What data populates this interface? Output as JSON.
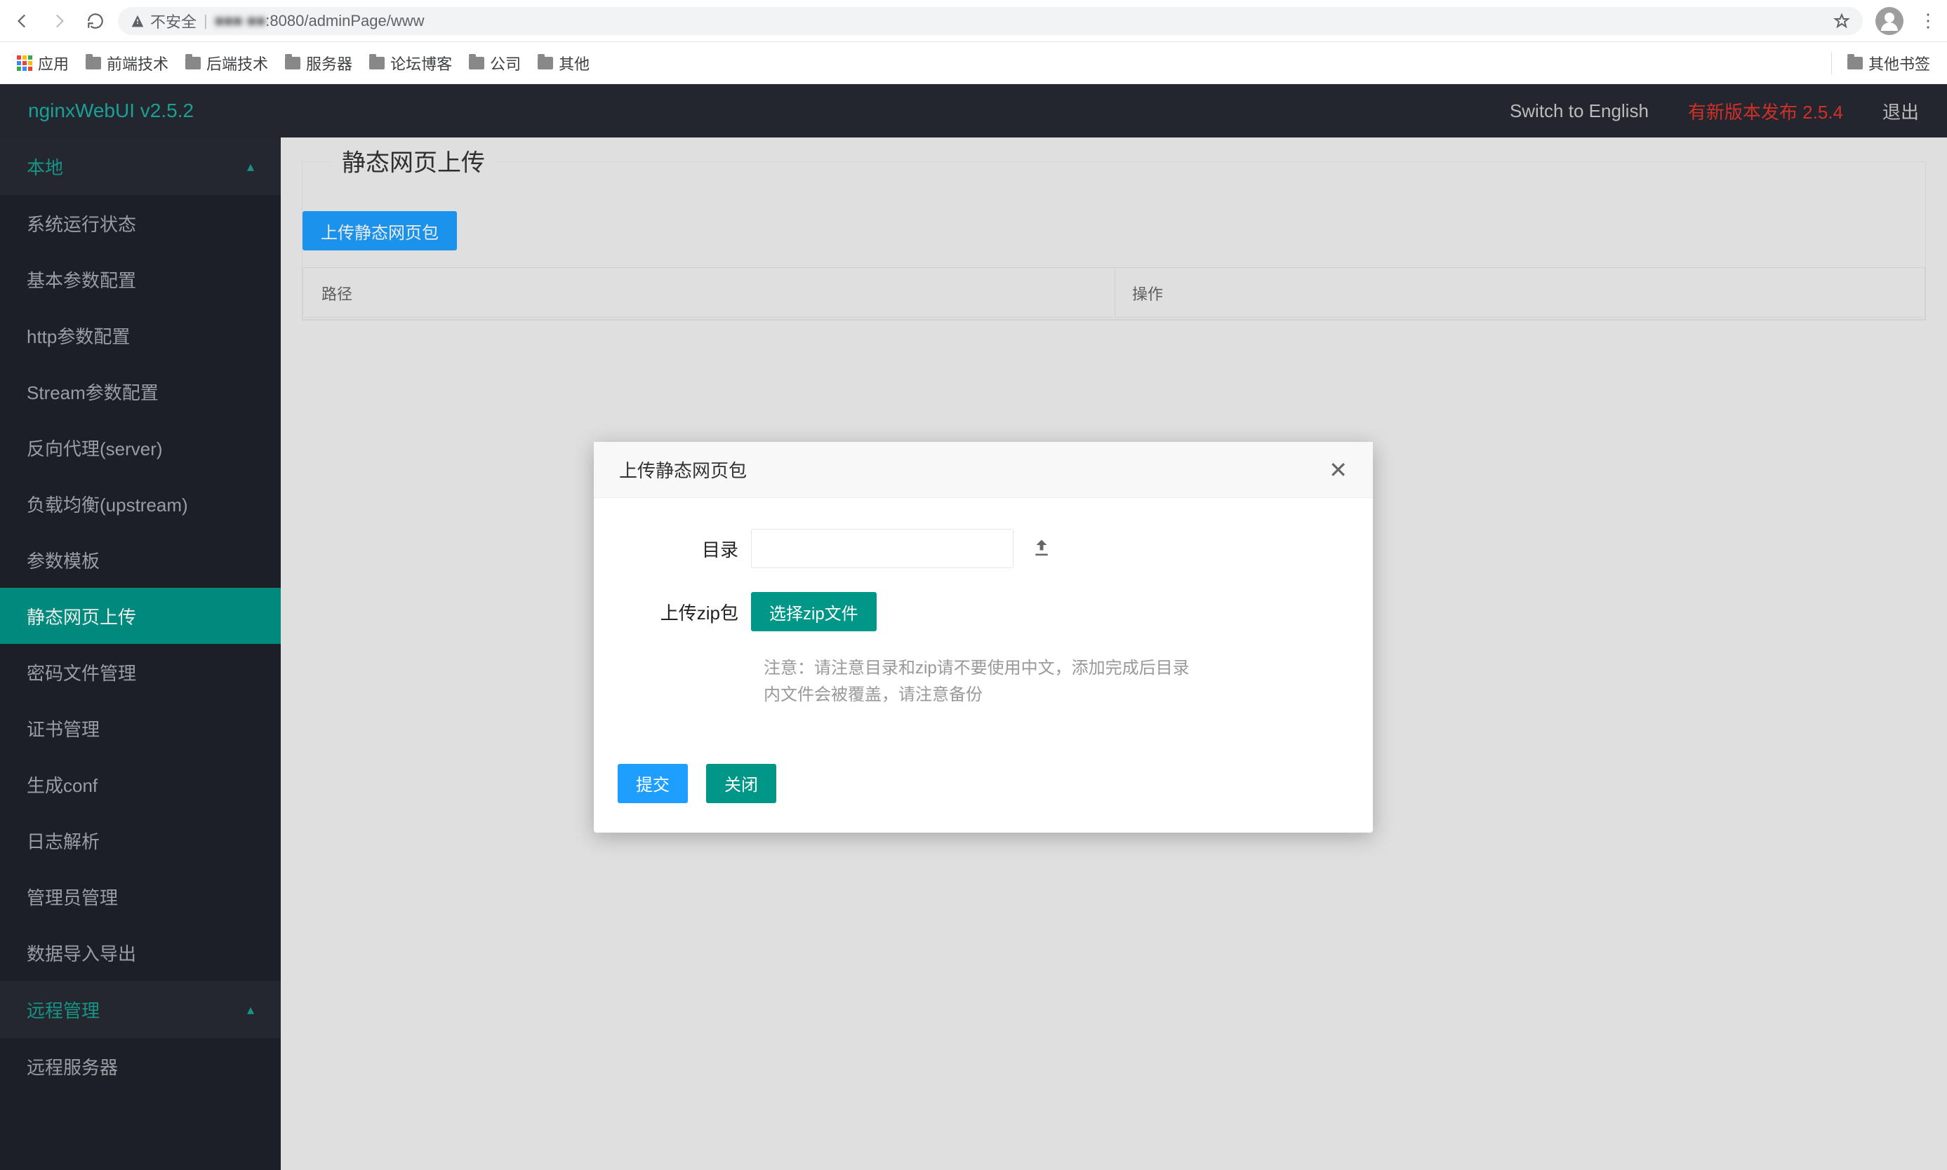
{
  "browser": {
    "insecure_label": "不安全",
    "url_host_obscured": "■■■ ■■",
    "url_rest": ":8080/adminPage/www",
    "apps_label": "应用",
    "bookmarks": [
      "前端技术",
      "后端技术",
      "服务器",
      "论坛博客",
      "公司",
      "其他"
    ],
    "other_bookmarks": "其他书签"
  },
  "header": {
    "brand": "nginxWebUI v2.5.2",
    "switch_lang": "Switch to English",
    "new_version": "有新版本发布 2.5.4",
    "logout": "退出"
  },
  "sidebar": {
    "group_local": "本地",
    "items": [
      "系统运行状态",
      "基本参数配置",
      "http参数配置",
      "Stream参数配置",
      "反向代理(server)",
      "负载均衡(upstream)",
      "参数模板",
      "静态网页上传",
      "密码文件管理",
      "证书管理",
      "生成conf",
      "日志解析",
      "管理员管理",
      "数据导入导出"
    ],
    "active_index": 7,
    "group_remote": "远程管理",
    "remote_items": [
      "远程服务器"
    ]
  },
  "page": {
    "title": "静态网页上传",
    "upload_btn": "上传静态网页包",
    "table": {
      "col_path": "路径",
      "col_action": "操作"
    }
  },
  "modal": {
    "title": "上传静态网页包",
    "dir_label": "目录",
    "zip_label": "上传zip包",
    "choose_zip": "选择zip文件",
    "note": "注意：请注意目录和zip请不要使用中文，添加完成后目录内文件会被覆盖，请注意备份",
    "submit": "提交",
    "close": "关闭"
  }
}
